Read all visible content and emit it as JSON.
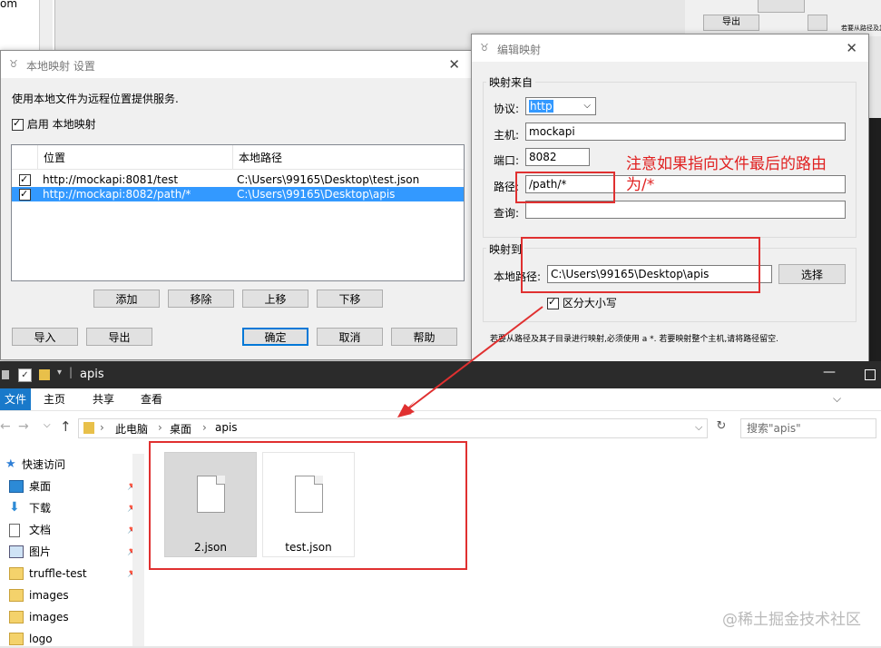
{
  "background": {
    "left_text": "om",
    "export_btn": "导出",
    "right_note": "若要从路径及其"
  },
  "local_mapping": {
    "title": "本地映射 设置",
    "description": "使用本地文件为远程位置提供服务.",
    "enable_label": "启用 本地映射",
    "columns": [
      "位置",
      "本地路径"
    ],
    "rows": [
      {
        "checked": true,
        "location": "http://mockapi:8081/test",
        "local_path": "C:\\Users\\99165\\Desktop\\test.json",
        "selected": false
      },
      {
        "checked": true,
        "location": "http://mockapi:8082/path/*",
        "local_path": "C:\\Users\\99165\\Desktop\\apis",
        "selected": true
      }
    ],
    "buttons": {
      "add": "添加",
      "remove": "移除",
      "up": "上移",
      "down": "下移",
      "import": "导入",
      "export": "导出",
      "ok": "确定",
      "cancel": "取消",
      "help": "帮助"
    }
  },
  "edit_mapping": {
    "title": "编辑映射",
    "from_group": "映射来自",
    "protocol_label": "协议:",
    "protocol_value": "http",
    "host_label": "主机:",
    "host_value": "mockapi",
    "port_label": "端口:",
    "port_value": "8082",
    "path_label": "路径:",
    "path_value": "/path/*",
    "query_label": "查询:",
    "query_value": "",
    "to_group": "映射到",
    "local_path_label": "本地路径:",
    "local_path_value": "C:\\Users\\99165\\Desktop\\apis",
    "choose_button": "选择",
    "case_sensitive_label": "区分大小写",
    "footer_note": "若要从路径及其子目录进行映射,必须使用 a *. 若要映射整个主机,请将路径留空."
  },
  "annotation": {
    "note_line1": "注意如果指向文件最后的路由",
    "note_line2": "为/*",
    "color": "#e02020"
  },
  "explorer": {
    "title": "apis",
    "tabs": [
      "文件",
      "主页",
      "共享",
      "查看"
    ],
    "breadcrumb": [
      "此电脑",
      "桌面",
      "apis"
    ],
    "search_placeholder": "搜索\"apis\"",
    "nav": [
      {
        "label": "快速访问",
        "icon": "star-icon",
        "pinned": false
      },
      {
        "label": "桌面",
        "icon": "desktop-icon",
        "pinned": true
      },
      {
        "label": "下载",
        "icon": "download-icon",
        "pinned": true
      },
      {
        "label": "文档",
        "icon": "document-icon",
        "pinned": true
      },
      {
        "label": "图片",
        "icon": "pictures-icon",
        "pinned": true
      },
      {
        "label": "truffle-test",
        "icon": "folder-icon",
        "pinned": true
      },
      {
        "label": "images",
        "icon": "folder-icon",
        "pinned": false
      },
      {
        "label": "images",
        "icon": "folder-icon",
        "pinned": false
      },
      {
        "label": "logo",
        "icon": "folder-icon",
        "pinned": false
      }
    ],
    "files": [
      {
        "name": "2.json",
        "selected": true
      },
      {
        "name": "test.json",
        "selected": false
      }
    ]
  },
  "watermark": "@稀土掘金技术社区",
  "colors": {
    "selection": "#3399ff",
    "accent": "#0078d7",
    "annotation": "#e02020",
    "explorer_title": "#2b2b2b"
  }
}
